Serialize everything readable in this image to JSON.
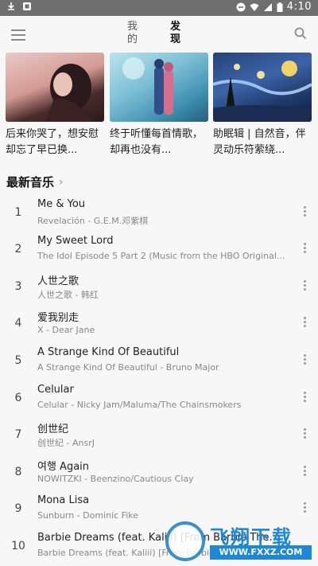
{
  "status_bar": {
    "time": "4:10"
  },
  "app_bar": {
    "tabs": [
      {
        "label": "我的"
      },
      {
        "label": "发现"
      }
    ]
  },
  "cards": [
    {
      "title": "后来你哭了，想安慰却忘了早已换..."
    },
    {
      "title": "终于听懂每首情歌，却再也没有..."
    },
    {
      "title": "助眠辑 | 自然音，伴灵动乐符萦绕..."
    }
  ],
  "section": {
    "title": "最新音乐"
  },
  "songs": [
    {
      "num": "1",
      "title": "Me & You",
      "sub": "Revelación - G.E.M.邓紫棋"
    },
    {
      "num": "2",
      "title": "My Sweet Lord",
      "sub": "The Idol Episode 5 Part 2 (Music from the HBO Original..."
    },
    {
      "num": "3",
      "title": "人世之歌",
      "sub": "人世之歌 - 韩红"
    },
    {
      "num": "4",
      "title": "爱我别走",
      "sub": "X - Dear Jane"
    },
    {
      "num": "5",
      "title": "A Strange Kind Of Beautiful",
      "sub": "A Strange Kind Of Beautiful - Bruno Major"
    },
    {
      "num": "6",
      "title": "Celular",
      "sub": "Celular - Nicky Jam/Maluma/The Chainsmokers"
    },
    {
      "num": "7",
      "title": "创世纪",
      "sub": "创世纪 - AnsrJ"
    },
    {
      "num": "8",
      "title": "여행 Again",
      "sub": "NOWITZKI - Beenzino/Cautious Clay"
    },
    {
      "num": "9",
      "title": "Mona Lisa",
      "sub": "Sunburn - Dominic Fike"
    },
    {
      "num": "10",
      "title": "Barbie Dreams (feat. Kaliii) [From Barbie The...",
      "sub": "Barbie Dreams (feat. Kaliii) [From Barbie The Album]"
    }
  ],
  "watermark": {
    "text": "飞翔下载",
    "url": "WWW.FXXZ.COM"
  }
}
